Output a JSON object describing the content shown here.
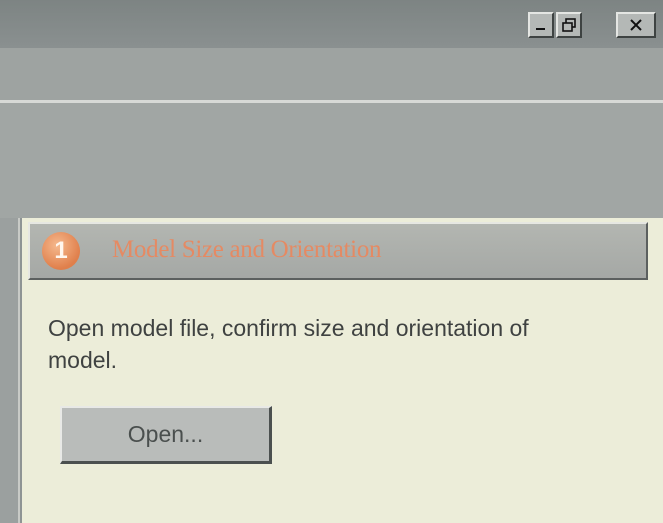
{
  "window": {
    "controls": [
      {
        "name": "minimize-button",
        "icon": "minimize-icon"
      },
      {
        "name": "maximize-button",
        "icon": "maximize-icon"
      },
      {
        "name": "close-button",
        "icon": "close-icon"
      }
    ]
  },
  "step": {
    "number": "1",
    "title": "Model Size and Orientation",
    "description": "Open model file, confirm size and orientation of model.",
    "button_label": "Open...",
    "colors": {
      "accent": "#e58a63",
      "badge": "#e07f4b",
      "panel_bg": "#ecedd9"
    }
  }
}
